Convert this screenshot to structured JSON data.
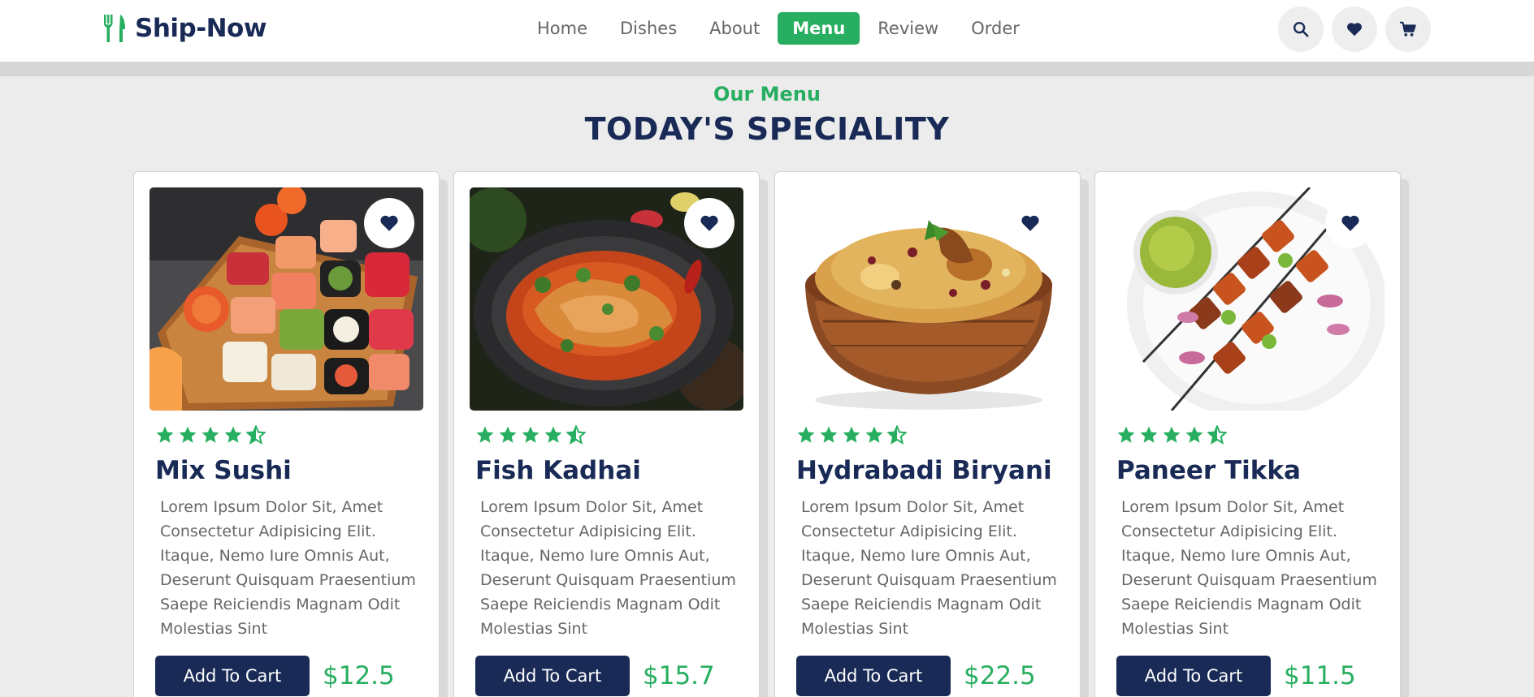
{
  "brand": {
    "name": "Ship-Now",
    "accent": "#27ae60",
    "primary": "#192a56"
  },
  "nav": {
    "items": [
      {
        "label": "Home"
      },
      {
        "label": "Dishes"
      },
      {
        "label": "About"
      },
      {
        "label": "Menu",
        "active": true
      },
      {
        "label": "Review"
      },
      {
        "label": "Order"
      }
    ]
  },
  "header_icons": [
    "search-icon",
    "heart-icon",
    "cart-icon"
  ],
  "section": {
    "subheading": "Our Menu",
    "heading": "TODAY'S SPECIALITY"
  },
  "cards": [
    {
      "title": "Mix Sushi",
      "rating": 4.5,
      "price": "$12.5",
      "button": "Add To Cart",
      "description": "Lorem Ipsum Dolor Sit, Amet Consectetur Adipisicing Elit. Itaque, Nemo Iure Omnis Aut, Deserunt Quisquam Praesentium Saepe Reiciendis Magnam Odit Molestias Sint"
    },
    {
      "title": "Fish Kadhai",
      "rating": 4.5,
      "price": "$15.7",
      "button": "Add To Cart",
      "description": "Lorem Ipsum Dolor Sit, Amet Consectetur Adipisicing Elit. Itaque, Nemo Iure Omnis Aut, Deserunt Quisquam Praesentium Saepe Reiciendis Magnam Odit Molestias Sint"
    },
    {
      "title": "Hydrabadi Biryani",
      "rating": 4.5,
      "price": "$22.5",
      "button": "Add To Cart",
      "description": "Lorem Ipsum Dolor Sit, Amet Consectetur Adipisicing Elit. Itaque, Nemo Iure Omnis Aut, Deserunt Quisquam Praesentium Saepe Reiciendis Magnam Odit Molestias Sint"
    },
    {
      "title": "Paneer Tikka",
      "rating": 4.5,
      "price": "$11.5",
      "button": "Add To Cart",
      "description": "Lorem Ipsum Dolor Sit, Amet Consectetur Adipisicing Elit. Itaque, Nemo Iure Omnis Aut, Deserunt Quisquam Praesentium Saepe Reiciendis Magnam Odit Molestias Sint"
    }
  ]
}
